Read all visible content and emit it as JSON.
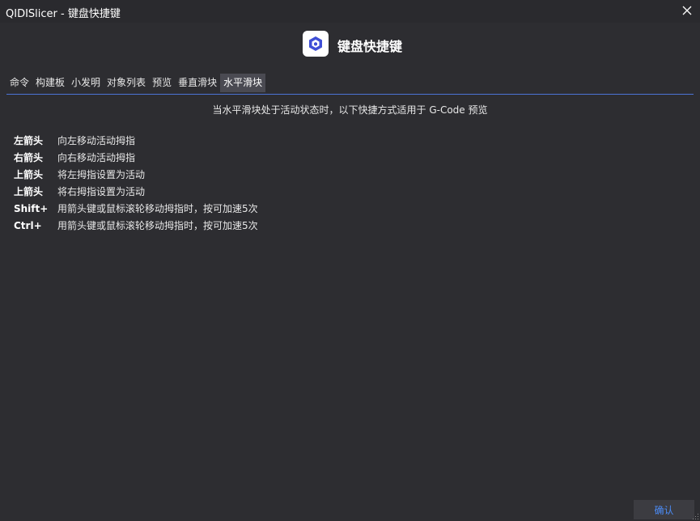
{
  "window": {
    "title": "QIDISlicer - 键盘快捷键",
    "close_icon": "close-icon"
  },
  "header": {
    "logo_icon": "qidi-logo-icon",
    "heading": "键盘快捷键"
  },
  "tabs": [
    {
      "label": "命令",
      "active": false
    },
    {
      "label": "构建板",
      "active": false
    },
    {
      "label": "小发明",
      "active": false
    },
    {
      "label": "对象列表",
      "active": false
    },
    {
      "label": "预览",
      "active": false
    },
    {
      "label": "垂直滑块",
      "active": false
    },
    {
      "label": "水平滑块",
      "active": true
    }
  ],
  "description": "当水平滑块处于活动状态时，以下快捷方式适用于 G-Code 预览",
  "shortcuts": [
    {
      "key": "左箭头",
      "action": "向左移动活动拇指"
    },
    {
      "key": "右箭头",
      "action": "向右移动活动拇指"
    },
    {
      "key": "上箭头",
      "action": "将左拇指设置为活动"
    },
    {
      "key": "上箭头",
      "action": "将右拇指设置为活动"
    },
    {
      "key": "Shift+",
      "action": "用箭头键或鼠标滚轮移动拇指时，按可加速5次"
    },
    {
      "key": "Ctrl+",
      "action": "用箭头键或鼠标滚轮移动拇指时，按可加速5次"
    }
  ],
  "footer": {
    "ok_label": "确认"
  },
  "colors": {
    "accent": "#4b73d6",
    "button_text": "#4b8bf5",
    "background": "#2d2d31"
  }
}
